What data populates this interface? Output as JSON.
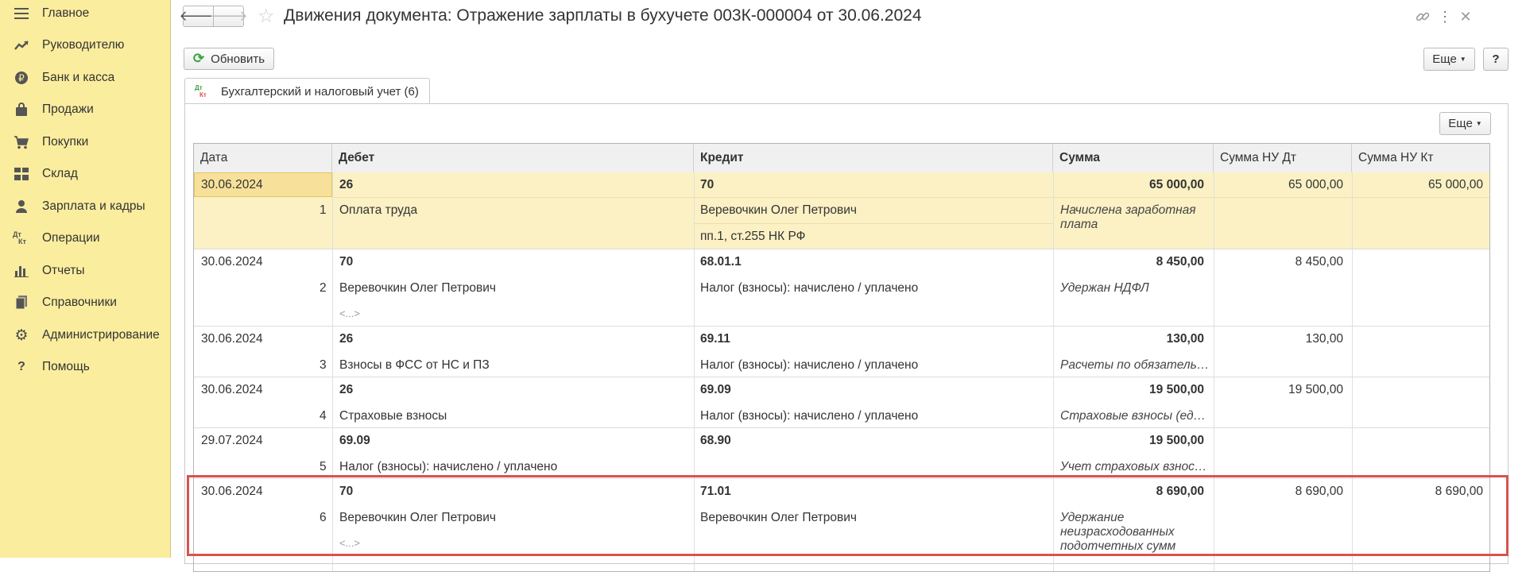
{
  "sidebar": {
    "items": [
      {
        "label": "Главное",
        "icon": "menu-icon"
      },
      {
        "label": "Руководителю",
        "icon": "trend-icon"
      },
      {
        "label": "Банк и касса",
        "icon": "ruble-icon"
      },
      {
        "label": "Продажи",
        "icon": "bag-icon"
      },
      {
        "label": "Покупки",
        "icon": "cart-icon"
      },
      {
        "label": "Склад",
        "icon": "warehouse-icon"
      },
      {
        "label": "Зарплата и кадры",
        "icon": "person-icon"
      },
      {
        "label": "Операции",
        "icon": "dt-kt-icon"
      },
      {
        "label": "Отчеты",
        "icon": "bar-chart-icon"
      },
      {
        "label": "Справочники",
        "icon": "books-icon"
      },
      {
        "label": "Администрирование",
        "icon": "gear-icon"
      },
      {
        "label": "Помощь",
        "icon": "question-icon"
      }
    ]
  },
  "header": {
    "title": "Движения документа: Отражение зарплаты в бухучете 003К-000004 от 30.06.2024"
  },
  "toolbar": {
    "refresh_label": "Обновить",
    "more_label": "Еще",
    "help_label": "?"
  },
  "tab": {
    "label": "Бухгалтерский и налоговый учет (6)",
    "icon_text_top": "Дт",
    "icon_text_bottom": "Кт"
  },
  "table": {
    "more_label": "Еще",
    "columns": [
      "Дата",
      "Дебет",
      "Кредит",
      "Сумма",
      "Сумма НУ Дт",
      "Сумма НУ Кт"
    ],
    "rows": [
      {
        "date": "30.06.2024",
        "num": "1",
        "debit": "26",
        "debit_sub": "Оплата труда",
        "debit_sub2": "",
        "credit": "70",
        "credit_sub": "Веревочкин Олег Петрович",
        "credit_sub2": "пп.1, ст.255 НК РФ",
        "sum": "65 000,00",
        "desc": "Начислена заработная плата",
        "nu_dt": "65 000,00",
        "nu_kt": "65 000,00"
      },
      {
        "date": "30.06.2024",
        "num": "2",
        "debit": "70",
        "debit_sub": "Веревочкин Олег Петрович",
        "debit_sub2": "<...>",
        "credit": "68.01.1",
        "credit_sub": "Налог (взносы): начислено / уплачено",
        "credit_sub2": "",
        "sum": "8 450,00",
        "desc": "Удержан НДФЛ",
        "nu_dt": "8 450,00",
        "nu_kt": ""
      },
      {
        "date": "30.06.2024",
        "num": "3",
        "debit": "26",
        "debit_sub": "Взносы в ФСС от НС и ПЗ",
        "debit_sub2": "",
        "credit": "69.11",
        "credit_sub": "Налог (взносы): начислено / уплачено",
        "credit_sub2": "",
        "sum": "130,00",
        "desc": "Расчеты по обязатель…",
        "nu_dt": "130,00",
        "nu_kt": ""
      },
      {
        "date": "30.06.2024",
        "num": "4",
        "debit": "26",
        "debit_sub": "Страховые взносы",
        "debit_sub2": "",
        "credit": "69.09",
        "credit_sub": "Налог (взносы): начислено / уплачено",
        "credit_sub2": "",
        "sum": "19 500,00",
        "desc": "Страховые взносы (ед…",
        "nu_dt": "19 500,00",
        "nu_kt": ""
      },
      {
        "date": "29.07.2024",
        "num": "5",
        "debit": "69.09",
        "debit_sub": "Налог (взносы): начислено / уплачено",
        "debit_sub2": "",
        "credit": "68.90",
        "credit_sub": "",
        "credit_sub2": "",
        "sum": "19 500,00",
        "desc": "Учет страховых взнос…",
        "nu_dt": "",
        "nu_kt": ""
      },
      {
        "date": "30.06.2024",
        "num": "6",
        "debit": "70",
        "debit_sub": "Веревочкин Олег Петрович",
        "debit_sub2": "<...>",
        "credit": "71.01",
        "credit_sub": "Веревочкин Олег Петрович",
        "credit_sub2": "",
        "sum": "8 690,00",
        "desc": "Удержание неизрасходованных подотчетных сумм",
        "nu_dt": "8 690,00",
        "nu_kt": "8 690,00"
      }
    ]
  },
  "colors": {
    "sidebar_bg": "#fbed9e",
    "selected_row_bg": "#fbf1c4",
    "selected_cell_bg": "#f7e19a",
    "highlight_border": "#d9534f",
    "refresh_icon": "#3aa540"
  }
}
